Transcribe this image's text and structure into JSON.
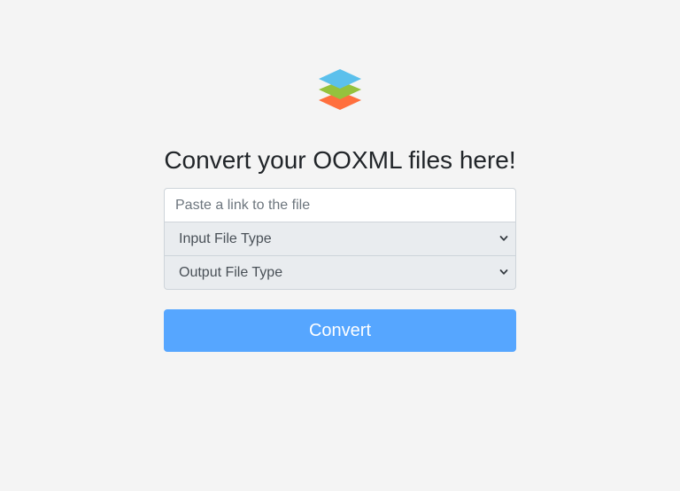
{
  "brand": {
    "logo_icon": "layers-icon",
    "colors": {
      "top_layer": "#5bc0ec",
      "middle_layer": "#95c23d",
      "bottom_layer": "#ff6f3d"
    }
  },
  "main": {
    "title": "Convert your OOXML files here!",
    "link_input": {
      "value": "",
      "placeholder": "Paste a link to the file"
    },
    "input_type_select": {
      "selected": "Input File Type",
      "icon": "chevron-down-icon"
    },
    "output_type_select": {
      "selected": "Output File Type",
      "icon": "chevron-down-icon"
    },
    "convert_button": {
      "label": "Convert",
      "color": "#56a6ff"
    }
  }
}
